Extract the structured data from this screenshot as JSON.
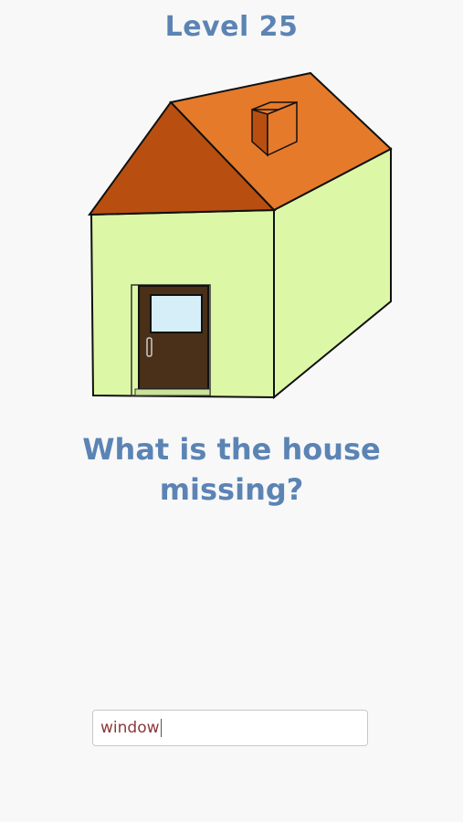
{
  "level": {
    "title": "Level 25"
  },
  "question": {
    "text": "What is the house missing?"
  },
  "answer": {
    "value": "window"
  },
  "colors": {
    "title_text": "#5b84b5",
    "roof_front": "#b84f10",
    "roof_side": "#e57a2a",
    "wall": "#dcf8a6",
    "door": "#4a3018",
    "door_window": "#d6eef8",
    "answer_text": "#8a3a3a"
  },
  "picture": {
    "subject": "house-with-door-and-chimney-no-windows"
  }
}
